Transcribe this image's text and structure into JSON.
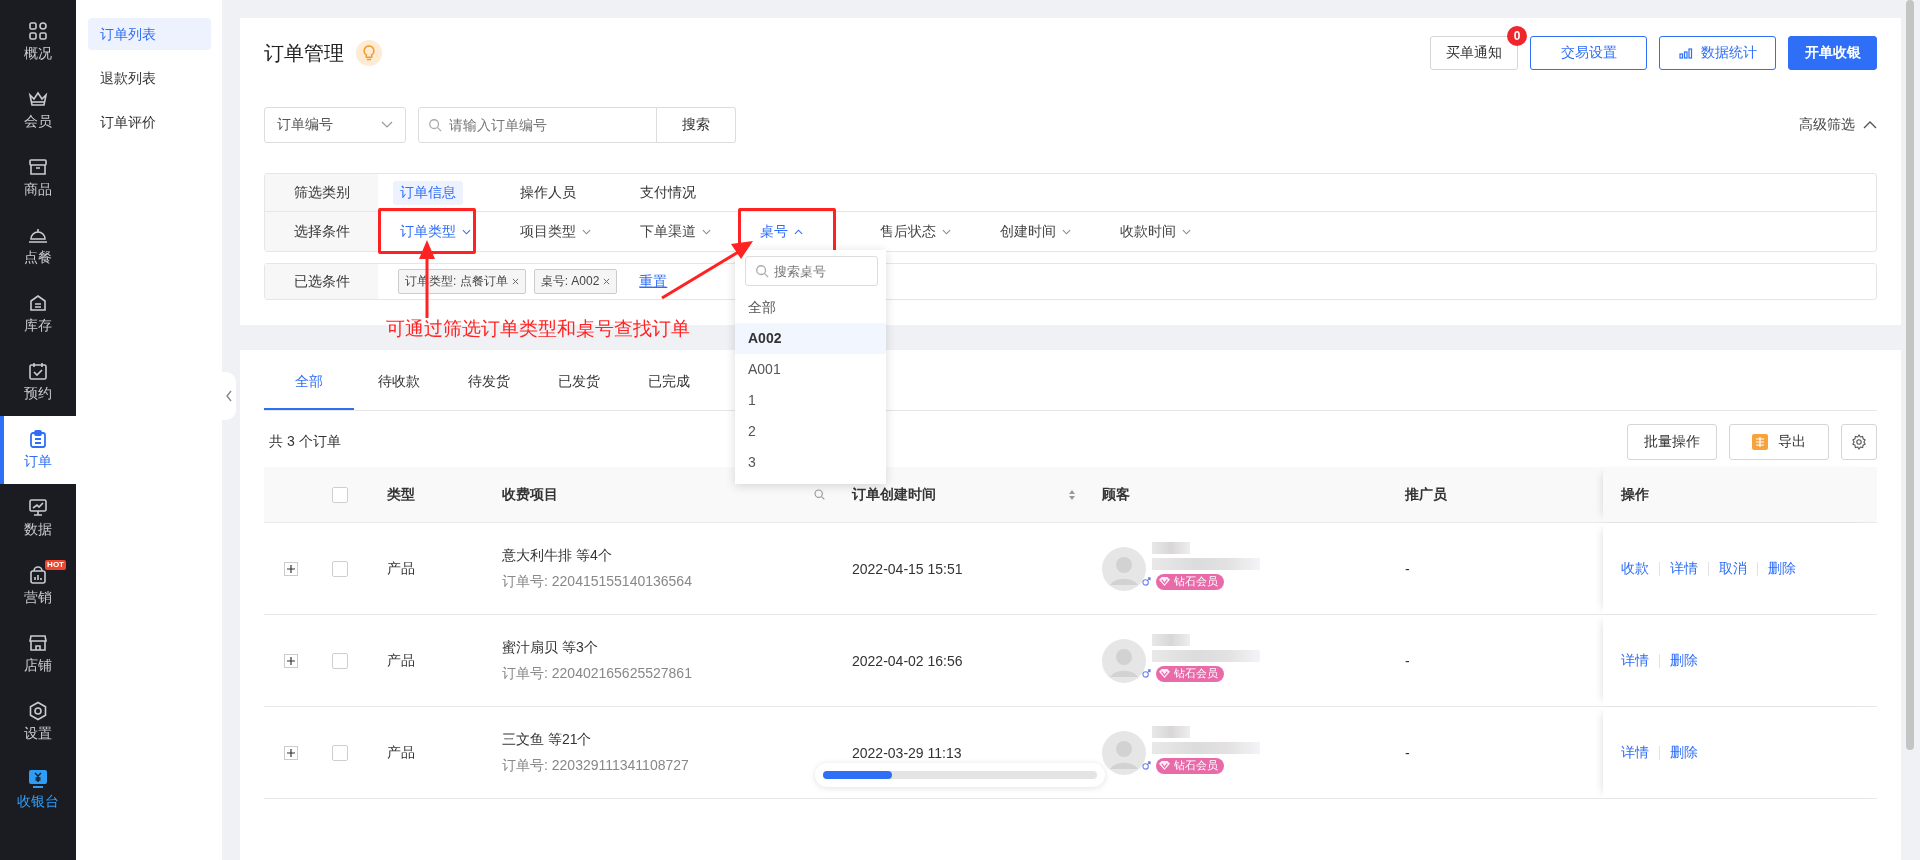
{
  "nav": [
    {
      "label": "概况",
      "selected": false,
      "accent": false
    },
    {
      "label": "会员",
      "selected": false,
      "accent": false
    },
    {
      "label": "商品",
      "selected": false,
      "accent": false
    },
    {
      "label": "点餐",
      "selected": false,
      "accent": false
    },
    {
      "label": "库存",
      "selected": false,
      "accent": false
    },
    {
      "label": "预约",
      "selected": false,
      "accent": false
    },
    {
      "label": "订单",
      "selected": true,
      "accent": false
    },
    {
      "label": "数据",
      "selected": false,
      "accent": false
    },
    {
      "label": "营销",
      "selected": false,
      "accent": false,
      "badge": "HOT"
    },
    {
      "label": "店铺",
      "selected": false,
      "accent": false
    },
    {
      "label": "设置",
      "selected": false,
      "accent": false
    },
    {
      "label": "收银台",
      "selected": false,
      "accent": true
    }
  ],
  "submenu": [
    {
      "label": "订单列表",
      "selected": true
    },
    {
      "label": "退款列表",
      "selected": false
    },
    {
      "label": "订单评价",
      "selected": false
    }
  ],
  "header": {
    "title": "订单管理",
    "buttons": [
      {
        "label": "买单通知",
        "kind": "plain",
        "badge": "0"
      },
      {
        "label": "交易设置",
        "kind": "outline"
      },
      {
        "label": "数据统计",
        "kind": "outline-chart"
      },
      {
        "label": "开单收银",
        "kind": "primary"
      }
    ]
  },
  "search": {
    "field_select": "订单编号",
    "placeholder": "请输入订单编号",
    "button": "搜索",
    "advanced": "高级筛选",
    "advanced_expanded": true
  },
  "filters": {
    "category_label": "筛选类别",
    "categories": [
      {
        "label": "订单信息",
        "selected": true
      },
      {
        "label": "操作人员",
        "selected": false
      },
      {
        "label": "支付情况",
        "selected": false
      }
    ],
    "condition_label": "选择条件",
    "conditions": [
      {
        "label": "订单类型",
        "active": true,
        "expanded": false,
        "highlighted": true
      },
      {
        "label": "项目类型",
        "active": false,
        "expanded": false,
        "highlighted": false
      },
      {
        "label": "下单渠道",
        "active": false,
        "expanded": false,
        "highlighted": false
      },
      {
        "label": "桌号",
        "active": true,
        "expanded": true,
        "highlighted": true
      },
      {
        "label": "售后状态",
        "active": false,
        "expanded": false,
        "highlighted": false
      },
      {
        "label": "创建时间",
        "active": false,
        "expanded": false,
        "highlighted": false
      },
      {
        "label": "收款时间",
        "active": false,
        "expanded": false,
        "highlighted": false
      }
    ],
    "selected_label": "已选条件",
    "tags": [
      "订单类型: 点餐订单",
      "桌号: A002"
    ],
    "reset": "重置"
  },
  "annotation": {
    "text": "可通过筛选订单类型和桌号查找订单"
  },
  "dropdown": {
    "placeholder": "搜索桌号",
    "options": [
      {
        "label": "全部",
        "selected": false
      },
      {
        "label": "A002",
        "selected": true
      },
      {
        "label": "A001",
        "selected": false
      },
      {
        "label": "1",
        "selected": false
      },
      {
        "label": "2",
        "selected": false
      },
      {
        "label": "3",
        "selected": false
      }
    ]
  },
  "tabs": [
    {
      "label": "全部",
      "selected": true
    },
    {
      "label": "待收款",
      "selected": false
    },
    {
      "label": "待发货",
      "selected": false
    },
    {
      "label": "已发货",
      "selected": false
    },
    {
      "label": "已完成",
      "selected": false
    }
  ],
  "count_text": "共 3 个订单",
  "toolbar": {
    "batch": "批量操作",
    "export": "导出"
  },
  "table": {
    "all_checked": false,
    "columns": [
      "类型",
      "收费项目",
      "订单创建时间",
      "顾客",
      "推广员",
      "操作"
    ],
    "rows": [
      {
        "checked": false,
        "type": "产品",
        "item": "意大利牛排 等4个",
        "order_no": "订单号: 220415155140136564",
        "created": "2022-04-15 15:51",
        "member_badge": "钻石会员",
        "promoter": "-",
        "actions": [
          "收款",
          "详情",
          "取消",
          "删除"
        ]
      },
      {
        "checked": false,
        "type": "产品",
        "item": "蜜汁扇贝 等3个",
        "order_no": "订单号: 220402165625527861",
        "created": "2022-04-02 16:56",
        "member_badge": "钻石会员",
        "promoter": "-",
        "actions": [
          "详情",
          "删除"
        ]
      },
      {
        "checked": false,
        "type": "产品",
        "item": "三文鱼 等21个",
        "order_no": "订单号: 220329111341108727",
        "created": "2022-03-29 11:13",
        "member_badge": "钻石会员",
        "promoter": "-",
        "actions": [
          "详情",
          "删除"
        ]
      }
    ]
  },
  "progress": {
    "level": 0.25
  }
}
